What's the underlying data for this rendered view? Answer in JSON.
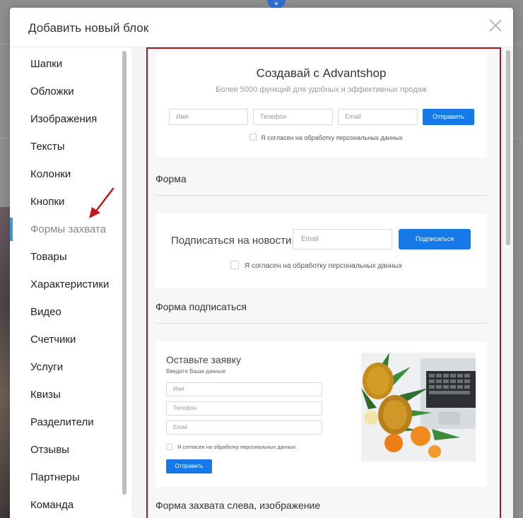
{
  "modal": {
    "title": "Добавить новый блок"
  },
  "sidebar": {
    "items": [
      {
        "label": "Шапки"
      },
      {
        "label": "Обложки"
      },
      {
        "label": "Изображения"
      },
      {
        "label": "Тексты"
      },
      {
        "label": "Колонки"
      },
      {
        "label": "Кнопки"
      },
      {
        "label": "Формы захвата",
        "active": true
      },
      {
        "label": "Товары"
      },
      {
        "label": "Характеристики"
      },
      {
        "label": "Видео"
      },
      {
        "label": "Счетчики"
      },
      {
        "label": "Услуги"
      },
      {
        "label": "Квизы"
      },
      {
        "label": "Разделители"
      },
      {
        "label": "Отзывы"
      },
      {
        "label": "Партнеры"
      },
      {
        "label": "Команда"
      }
    ]
  },
  "blocks": {
    "form": {
      "heading": "Создавай с Advantshop",
      "subheading": "Более 5000 функций для удобных и эффективных продаж",
      "name_placeholder": "Имя",
      "phone_placeholder": "Телефон",
      "email_placeholder": "Email",
      "submit_label": "Отправить",
      "consent_label": "Я согласен на обработку персональных данных",
      "title": "Форма"
    },
    "subscribe": {
      "heading": "Подписаться на новости",
      "email_placeholder": "Email",
      "submit_label": "Подписаться",
      "consent_label": "Я согласен на обработку персональных данных",
      "title": "Форма подписаться"
    },
    "left_image": {
      "heading": "Оставьте заявку",
      "subheading": "Введите Ваши данные",
      "name_placeholder": "Имя",
      "phone_placeholder": "Телефон",
      "email_placeholder": "Email",
      "consent_label": "Я согласен на обработку персональных данных",
      "submit_label": "Отправить",
      "title": "Форма захвата слева, изображение"
    }
  },
  "colors": {
    "accent": "#1579e8",
    "highlight_border": "#a3191d",
    "active_indicator": "#4a90d6",
    "annotation_arrow": "#c0171c"
  },
  "icons": {
    "close": "close-icon",
    "add": "plus-icon",
    "arrow": "annotation-arrow"
  }
}
